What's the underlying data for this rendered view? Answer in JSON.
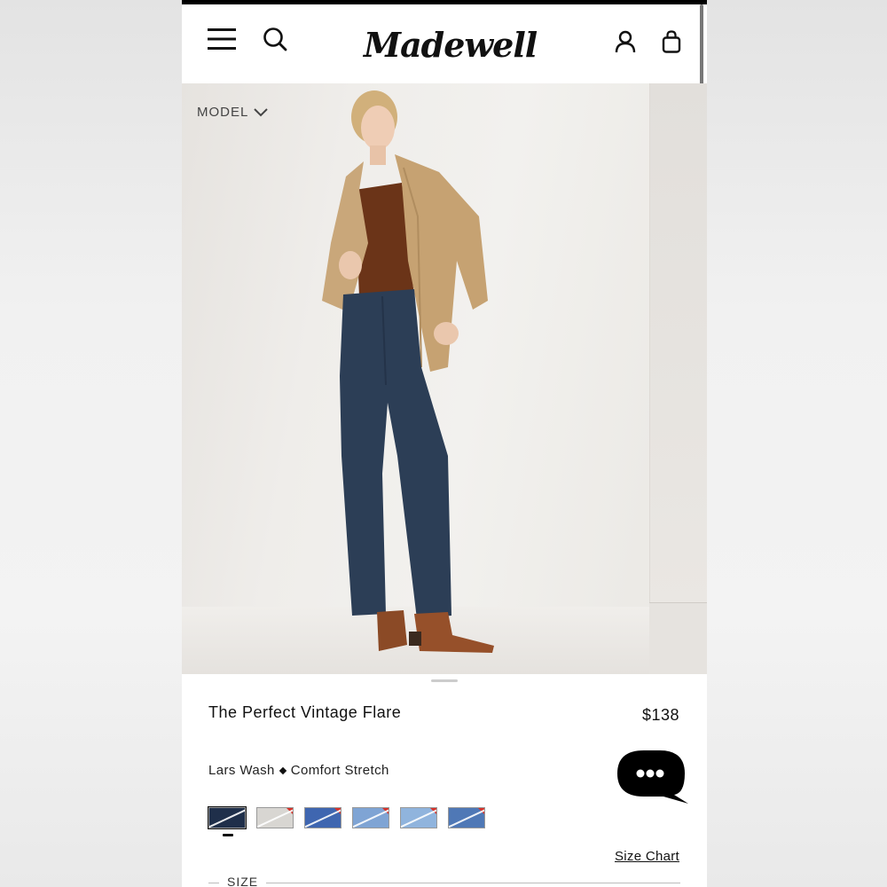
{
  "header": {
    "brand": "Madewell",
    "menu_icon": "hamburger-menu-icon",
    "search_icon": "search-icon",
    "account_icon": "account-icon",
    "bag_icon": "shopping-bag-icon"
  },
  "gallery": {
    "model_toggle_label": "MODEL"
  },
  "product": {
    "title": "The Perfect Vintage Flare",
    "price": "$138",
    "wash": "Lars Wash",
    "fit": "Comfort Stretch",
    "swatches": [
      {
        "color": "#1f2f4a",
        "selected": true
      },
      {
        "color": "#d8d6d2",
        "selected": false
      },
      {
        "color": "#3f66b0",
        "selected": false
      },
      {
        "color": "#7fa4d4",
        "selected": false
      },
      {
        "color": "#90b4dd",
        "selected": false
      },
      {
        "color": "#4f78b6",
        "selected": false
      }
    ],
    "size_chart_label": "Size Chart",
    "size_label": "SIZE"
  },
  "chat": {
    "icon": "chat-bubble-icon"
  },
  "colors": {
    "accent": "#111111",
    "swatch_flag": "#d6332b"
  }
}
